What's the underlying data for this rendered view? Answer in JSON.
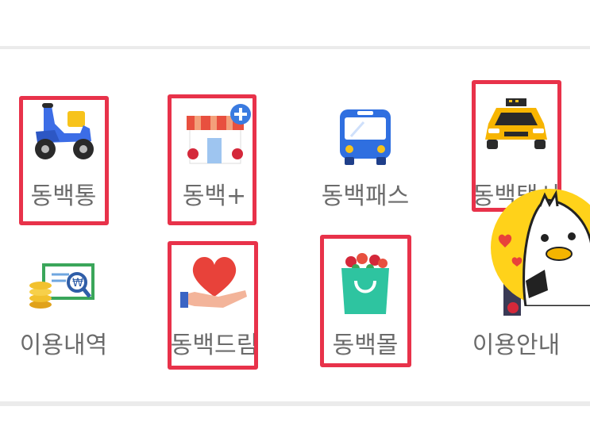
{
  "menu": {
    "items": [
      {
        "label": "동백통",
        "icon": "scooter-icon"
      },
      {
        "label": "동백+",
        "icon": "store-plus-icon"
      },
      {
        "label": "동백패스",
        "icon": "bus-icon"
      },
      {
        "label": "동백택시",
        "icon": "taxi-icon"
      },
      {
        "label": "이용내역",
        "icon": "coins-receipt-icon"
      },
      {
        "label": "동백드림",
        "icon": "heart-hand-icon"
      },
      {
        "label": "동백몰",
        "icon": "shopping-bag-icon"
      },
      {
        "label": "이용안내",
        "icon": "guide-icon"
      }
    ]
  },
  "mascot": {
    "icon": "duck-mascot-icon"
  },
  "colors": {
    "highlight": "#e8324a",
    "label": "#6b6b6b"
  }
}
